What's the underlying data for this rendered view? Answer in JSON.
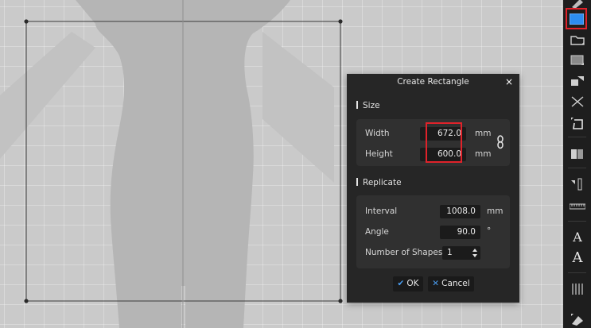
{
  "dialog": {
    "title": "Create Rectangle",
    "close_icon": "×",
    "size_section": {
      "heading": "Size",
      "width_label": "Width",
      "width_value": "672.0",
      "width_unit": "mm",
      "height_label": "Height",
      "height_value": "600.0",
      "height_unit": "mm",
      "link_icon": "link-icon"
    },
    "replicate_section": {
      "heading": "Replicate",
      "interval_label": "Interval",
      "interval_value": "1008.0",
      "interval_unit": "mm",
      "angle_label": "Angle",
      "angle_value": "90.0",
      "angle_unit": "°",
      "count_label": "Number of Shapes",
      "count_value": "1"
    },
    "ok_label": "OK",
    "cancel_label": "Cancel",
    "ok_icon": "✔",
    "cancel_icon": "✕"
  },
  "toolbar": {
    "items": [
      "pen-tool-icon",
      "rectangle-tool-icon",
      "folder-tool-icon",
      "texture-tool-icon",
      "shapes-tool-icon",
      "scissors-tool-icon",
      "transform-tool-icon",
      "book-tool-icon",
      "ruler-vertical-icon",
      "ruler-horizontal-icon",
      "text-tool-icon",
      "text-style-tool-icon",
      "grid-columns-icon",
      "fill-tool-icon"
    ],
    "active": "rectangle-tool-icon"
  },
  "colors": {
    "canvas_bg": "#cacaca",
    "silhouette": "#b5b5b5",
    "dialog_bg": "#262626",
    "accent": "#4a9df0",
    "highlight": "#e0222a",
    "active_tool": "#2d8cf0"
  }
}
